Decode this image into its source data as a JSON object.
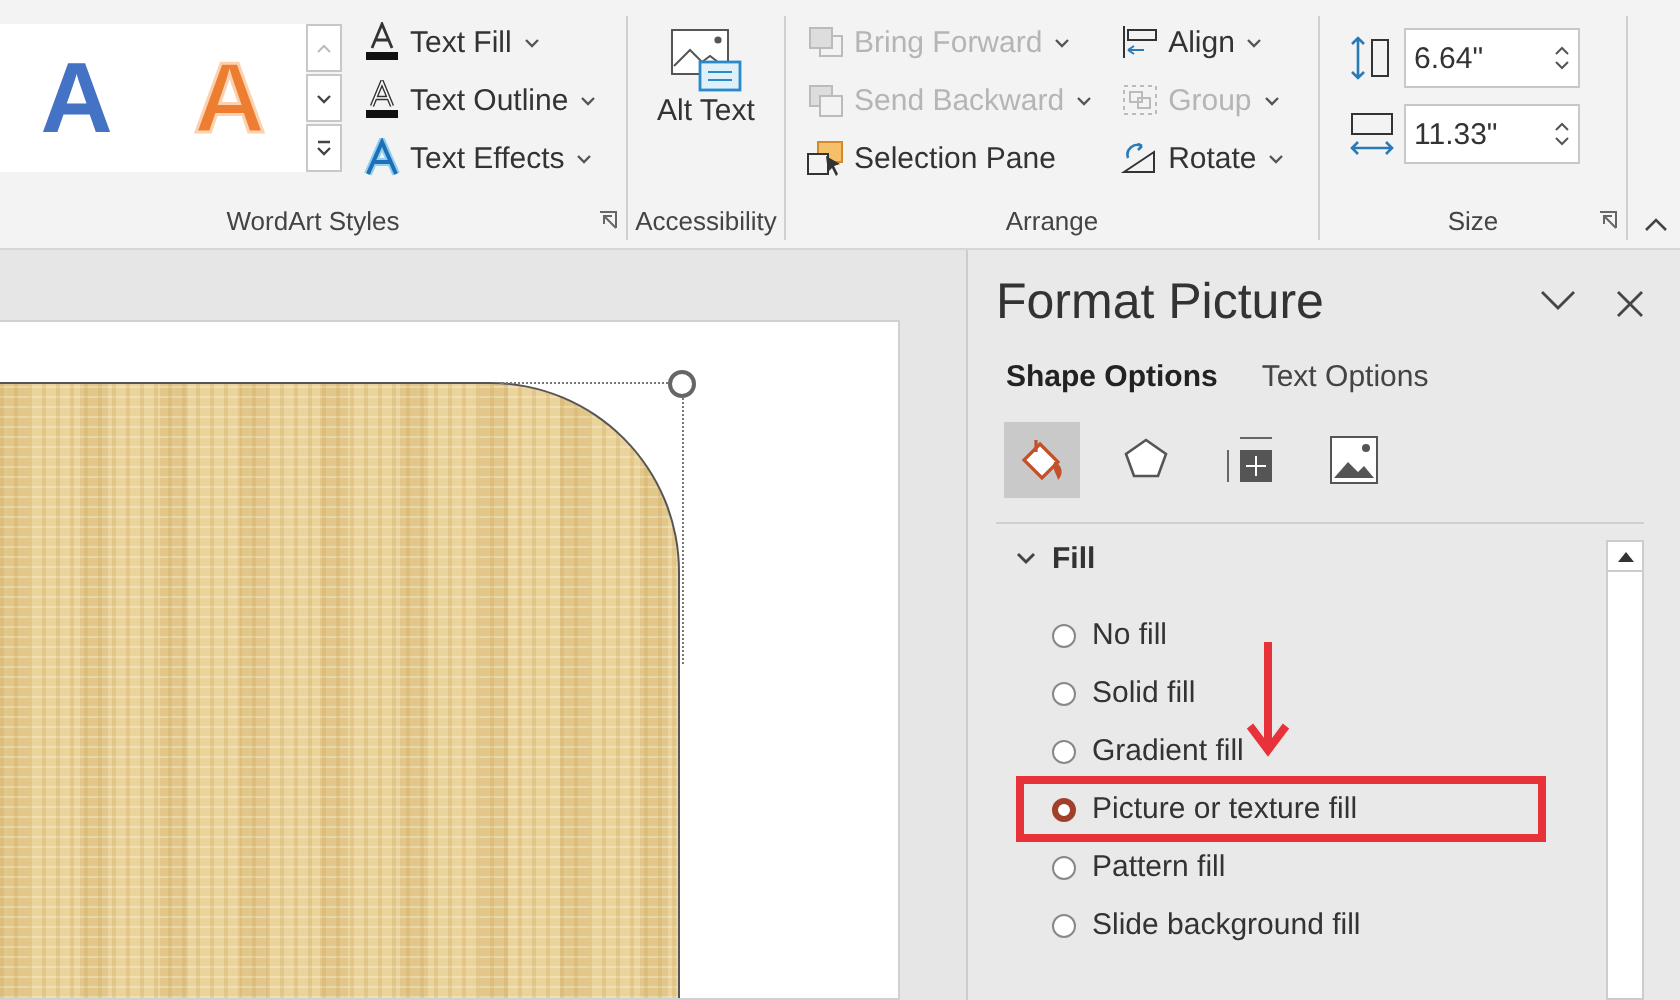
{
  "ribbon": {
    "wordart_styles": {
      "label": "WordArt Styles",
      "gallery": [
        {
          "glyph": "A",
          "color": "#4472c4",
          "kind": "filled"
        },
        {
          "glyph": "A",
          "color": "#ed7d31",
          "kind": "outlined"
        }
      ],
      "commands": [
        {
          "label": "Text Fill",
          "kind": "fill"
        },
        {
          "label": "Text Outline",
          "kind": "outline"
        },
        {
          "label": "Text Effects",
          "kind": "effects"
        }
      ]
    },
    "accessibility": {
      "label": "Accessibility",
      "button": "Alt Text"
    },
    "arrange": {
      "label": "Arrange",
      "commands": [
        {
          "label": "Bring Forward",
          "kind": "bring-forward",
          "disabled": true,
          "has_menu": true
        },
        {
          "label": "Send Backward",
          "kind": "send-backward",
          "disabled": true,
          "has_menu": true
        },
        {
          "label": "Selection Pane",
          "kind": "selection-pane",
          "disabled": false,
          "has_menu": false
        },
        {
          "label": "Align",
          "kind": "align",
          "disabled": false,
          "has_menu": true
        },
        {
          "label": "Group",
          "kind": "group",
          "disabled": true,
          "has_menu": true
        },
        {
          "label": "Rotate",
          "kind": "rotate",
          "disabled": false,
          "has_menu": true
        }
      ]
    },
    "size": {
      "label": "Size",
      "fields": [
        {
          "kind": "height",
          "value": "6.64\""
        },
        {
          "kind": "width",
          "value": "11.33\""
        }
      ]
    }
  },
  "format_pane": {
    "title": "Format Picture",
    "tabs": [
      {
        "label": "Shape Options",
        "selected": true
      },
      {
        "label": "Text Options",
        "selected": false
      }
    ],
    "icon_tabs": [
      {
        "kind": "fill",
        "selected": true
      },
      {
        "kind": "effects",
        "selected": false
      },
      {
        "kind": "size",
        "selected": false
      },
      {
        "kind": "picture",
        "selected": false
      }
    ],
    "section": {
      "title": "Fill",
      "expanded": true,
      "options": [
        {
          "label": "No fill",
          "selected": false,
          "highlighted": false
        },
        {
          "label": "Solid fill",
          "selected": false,
          "highlighted": false
        },
        {
          "label": "Gradient fill",
          "selected": false,
          "highlighted": false
        },
        {
          "label": "Picture or texture fill",
          "selected": true,
          "highlighted": true
        },
        {
          "label": "Pattern fill",
          "selected": false,
          "highlighted": false
        },
        {
          "label": "Slide background fill",
          "selected": false,
          "highlighted": false
        }
      ]
    }
  }
}
